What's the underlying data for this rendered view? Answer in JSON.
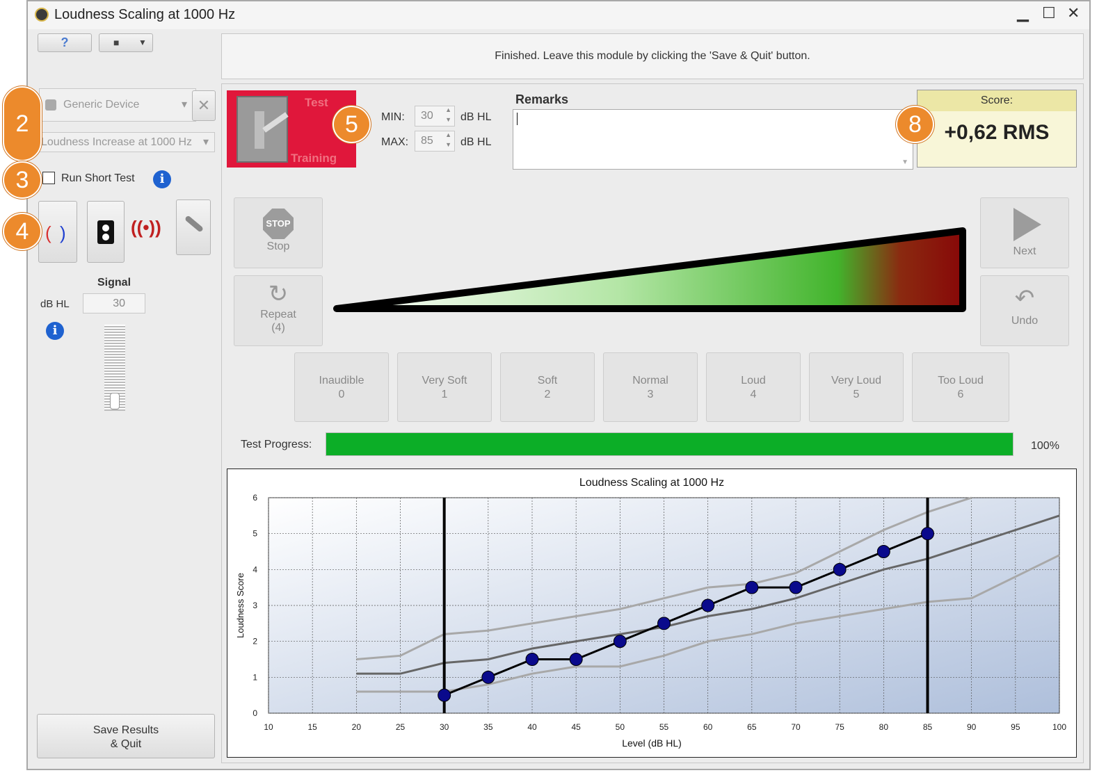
{
  "window": {
    "title": "Loudness Scaling at 1000 Hz",
    "minimize": "▁",
    "maximize": "☐",
    "close": "✕"
  },
  "toolbar": {
    "help_icon": "?",
    "camera_icon": "■",
    "camera_caret": "▼"
  },
  "device": {
    "selected": "Generic Device",
    "caret": "▾"
  },
  "test_type": {
    "selected": "Loudness Increase at 1000 Hz",
    "caret": "▾"
  },
  "short_test": {
    "label": "Run Short Test",
    "checked": false
  },
  "badges": {
    "b2": "2",
    "b3": "3",
    "b4": "4",
    "b5": "5",
    "b8": "8"
  },
  "info": {
    "symbol": "i"
  },
  "signal": {
    "title": "Signal",
    "unit": "dB HL",
    "value": "30"
  },
  "save": {
    "line1": "Save Results",
    "line2": "& Quit"
  },
  "status": {
    "message": "Finished. Leave this module by clicking the 'Save & Quit' button."
  },
  "mode_switch": {
    "top": "Test",
    "bottom": "Training"
  },
  "range": {
    "min_label": "MIN:",
    "min_value": "30",
    "max_label": "MAX:",
    "max_value": "85",
    "unit": "dB HL"
  },
  "remarks": {
    "label": "Remarks",
    "value": ""
  },
  "score": {
    "label": "Score:",
    "value": "+0,62 RMS"
  },
  "controls": {
    "stop_icon": "STOP",
    "stop": "Stop",
    "repeat": "Repeat",
    "repeat_count": "(4)",
    "next": "Next",
    "undo": "Undo"
  },
  "responses": [
    {
      "label": "Inaudible",
      "value": "0"
    },
    {
      "label": "Very Soft",
      "value": "1"
    },
    {
      "label": "Soft",
      "value": "2"
    },
    {
      "label": "Normal",
      "value": "3"
    },
    {
      "label": "Loud",
      "value": "4"
    },
    {
      "label": "Very Loud",
      "value": "5"
    },
    {
      "label": "Too Loud",
      "value": "6"
    }
  ],
  "progress": {
    "label": "Test Progress:",
    "value": 100,
    "text": "100%",
    "color": "#0cae27"
  },
  "colors": {
    "accent_red": "#e0173b",
    "score_bg": "#f8f6d8",
    "badge_orange": "#ec8a2c",
    "point": "#0a0a8c"
  },
  "chart_data": {
    "type": "line",
    "title": "Loudness Scaling at 1000 Hz",
    "xlabel": "Level (dB HL)",
    "ylabel": "Loudness Score",
    "xlim": [
      10,
      100
    ],
    "ylim": [
      0,
      6
    ],
    "xticks": [
      "10",
      "15",
      "20",
      "25",
      "30",
      "35",
      "40",
      "45",
      "50",
      "55",
      "60",
      "65",
      "70",
      "75",
      "80",
      "85",
      "90",
      "95",
      "100"
    ],
    "yticks": [
      "0",
      "1",
      "2",
      "3",
      "4",
      "5",
      "6"
    ],
    "grid": true,
    "vlines": [
      30,
      85
    ],
    "measured": {
      "x": [
        30,
        35,
        40,
        45,
        50,
        55,
        60,
        65,
        70,
        75,
        80,
        85
      ],
      "y": [
        0.5,
        1.0,
        1.5,
        1.5,
        2.0,
        2.5,
        3.0,
        3.5,
        3.5,
        4.0,
        4.5,
        5.0
      ]
    },
    "norm_median": {
      "x": [
        20,
        25,
        30,
        35,
        40,
        45,
        50,
        55,
        60,
        65,
        70,
        75,
        80,
        85,
        90,
        95,
        100
      ],
      "y": [
        1.1,
        1.1,
        1.4,
        1.5,
        1.8,
        2.0,
        2.2,
        2.4,
        2.7,
        2.9,
        3.2,
        3.6,
        4.0,
        4.3,
        4.7,
        5.1,
        5.5
      ]
    },
    "norm_upper": {
      "x": [
        20,
        25,
        30,
        35,
        40,
        45,
        50,
        55,
        60,
        65,
        70,
        75,
        80,
        85,
        90
      ],
      "y": [
        1.5,
        1.6,
        2.2,
        2.3,
        2.5,
        2.7,
        2.9,
        3.2,
        3.5,
        3.6,
        3.9,
        4.5,
        5.1,
        5.6,
        6.0
      ]
    },
    "norm_lower": {
      "x": [
        20,
        25,
        30,
        35,
        40,
        45,
        50,
        55,
        60,
        65,
        70,
        75,
        80,
        85,
        90,
        95,
        100
      ],
      "y": [
        0.6,
        0.6,
        0.6,
        0.8,
        1.1,
        1.3,
        1.3,
        1.6,
        2.0,
        2.2,
        2.5,
        2.7,
        2.9,
        3.1,
        3.2,
        3.8,
        4.4
      ]
    }
  }
}
